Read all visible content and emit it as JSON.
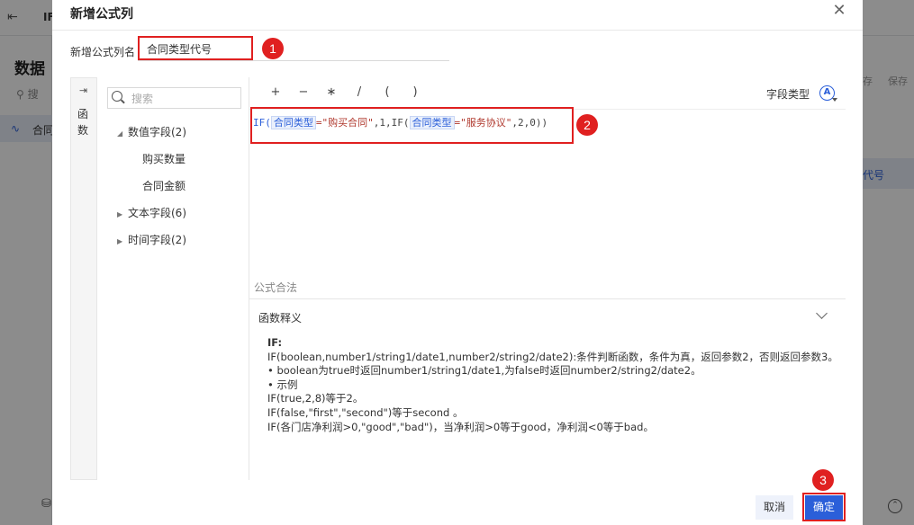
{
  "background": {
    "top_tab_text": "IF",
    "title": "数据",
    "search_placeholder": "搜",
    "item_label": "合同",
    "right_code": "代号",
    "right_tool_1": "存",
    "right_tool_2": "保存",
    "back_icon": "exit-icon",
    "bottom_icon": "database-icon",
    "collapse_icon": "chevron-up-circle-icon"
  },
  "dialog": {
    "title": "新增公式列",
    "close_icon": "close-icon",
    "name_label": "新增公式列名",
    "name_value": "合同类型代号",
    "side_label": "函数",
    "side_icon": "collapse-right-icon",
    "tree": {
      "search_placeholder": "搜索",
      "groups": [
        {
          "label": "数值字段(2)",
          "expanded": true,
          "children": [
            "购买数量",
            "合同金额"
          ]
        },
        {
          "label": "文本字段(6)",
          "expanded": false,
          "children": []
        },
        {
          "label": "时间字段(2)",
          "expanded": false,
          "children": []
        }
      ]
    },
    "toolbar": {
      "ops": [
        "+",
        "−",
        "∗",
        "/",
        "(",
        ")"
      ],
      "field_type_label": "字段类型",
      "field_type_icon": "A"
    },
    "formula": {
      "p1": "IF(",
      "f1": "合同类型",
      "s1": "=\"购买合同\"",
      "p2": ",1,IF(",
      "f2": "合同类型",
      "s2": "=\"服务协议\"",
      "p3": ",2,0))"
    },
    "valid_text": "公式合法",
    "description": {
      "title": "函数释义",
      "lines": [
        "IF:",
        "IF(boolean,number1/string1/date1,number2/string2/date2):条件判断函数，条件为真，返回参数2，否则返回参数3。",
        "• boolean为true时返回number1/string1/date1,为false时返回number2/string2/date2。",
        "• 示例",
        "IF(true,2,8)等于2。",
        "IF(false,\"first\",\"second\")等于second 。",
        "IF(各门店净利润>0,\"good\",\"bad\")，当净利润>0等于good，净利润<0等于bad。"
      ]
    },
    "buttons": {
      "cancel": "取消",
      "ok": "确定"
    }
  },
  "annotations": {
    "marker_1": "1",
    "marker_2": "2",
    "marker_3": "3",
    "color": "#e02020"
  },
  "colors": {
    "accent": "#2b5fd9",
    "annotation": "#e02020"
  }
}
